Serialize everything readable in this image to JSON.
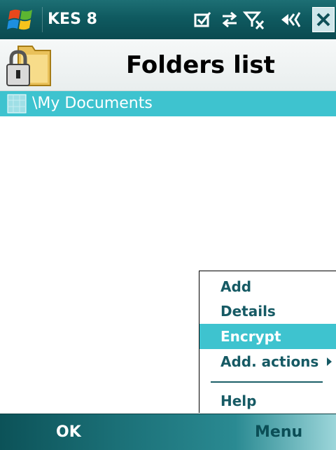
{
  "titlebar": {
    "app_title": "KES 8",
    "icons": [
      "windows-start-icon",
      "notification-check-icon",
      "connectivity-arrows-icon",
      "no-signal-icon",
      "speaker-icon",
      "close-icon"
    ]
  },
  "header": {
    "title": "Folders list",
    "icon": "encrypted-folder-lock-icon"
  },
  "folders": [
    {
      "label": "\\My Documents",
      "icon": "folder-item-icon",
      "selected": true
    }
  ],
  "menu": {
    "items": [
      {
        "label": "Add"
      },
      {
        "label": "Details"
      },
      {
        "label": "Encrypt",
        "selected": true
      },
      {
        "label": "Add. actions",
        "has_submenu": true
      },
      {
        "label": "Help"
      }
    ]
  },
  "softkeys": {
    "left": "OK",
    "right": "Menu"
  },
  "colors": {
    "titlebar": "#0f5a60",
    "selection": "#3ec3cf",
    "menu_text": "#165a64",
    "softkey_right_text": "#0b4e56"
  }
}
